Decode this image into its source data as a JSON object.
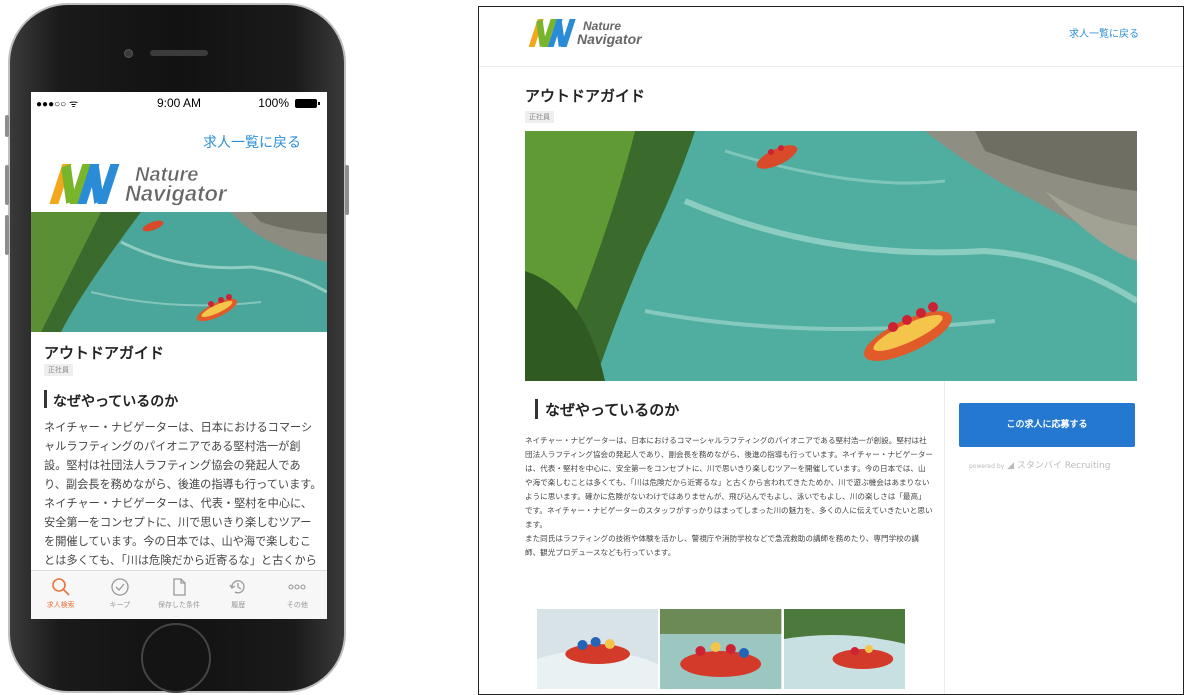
{
  "brand": {
    "line1": "Nature",
    "line2": "Navigator",
    "colors": [
      "#f2a71c",
      "#79b52a",
      "#2a8bd6",
      "#e8453c"
    ]
  },
  "status_bar": {
    "signal": "●●●○○ ᯤ",
    "time": "9:00 AM",
    "battery": "100%"
  },
  "job": {
    "back_link": "求人一覧に戻る",
    "title": "アウトドアガイド",
    "employment_type": "正社員",
    "section_title": "なぜやっているのか",
    "body": "ネイチャー・ナビゲーターは、日本におけるコマーシャルラフティングのパイオニアである堅村浩一が創設。堅村は社団法人ラフティング協会の発起人であり、副会長を務めながら、後進の指導も行っています。ネイチャー・ナビゲーターは、代表・堅村を中心に、安全第一をコンセプトに、川で思いきり楽しむツアーを開催しています。今の日本では、山や海で楽しむことは多くても、「川は危険だから近寄るな」と古くから言われてきたためか、川で遊ぶ機会はあまりないように思います。確かに危険がないわけではありませんが、飛び込んでもよし、泳いでもよし、川の楽しさは「最高」です。ネイチャー・ナビゲーターのスタッフがすっかりはまってしまった川の魅力を、多くの人に伝えていきたいと思います。",
    "body2": "また同氏はラフティングの技術や体験を活かし、警視庁や消防学校などで急流救助の講師を務めたり、専門学校の講師、観光プロデュースなども行っています。",
    "mobile_body_visible": "ネイチャー・ナビゲーターは、日本におけるコマーシャルラフティングのパイオニアである堅村浩一が創設。堅村は社団法人ラフティング協会の発起人であり、副会長を務めながら、後進の指導も行っています。ネイチャー・ナビゲーターは、代表・堅村を中心に、安全第一をコンセプトに、川で思いきり楽しむツアーを開催しています。今の日本では、山や海で楽しむことは多くても、「川は危険だから近寄るな」と古くから言われてきたためか、川で遊ぶ機会はあまりないように思います。"
  },
  "apply": {
    "button_label": "この求人に応募する",
    "powered_prefix": "powered by",
    "powered_brand": "スタンバイ",
    "powered_suffix": "Recruiting"
  },
  "tabbar": {
    "items": [
      {
        "label": "求人検索",
        "icon": "search-icon",
        "active": true
      },
      {
        "label": "キープ",
        "icon": "check-circle-icon",
        "active": false
      },
      {
        "label": "保存した条件",
        "icon": "document-icon",
        "active": false
      },
      {
        "label": "履歴",
        "icon": "history-icon",
        "active": false
      },
      {
        "label": "その他",
        "icon": "more-icon",
        "active": false
      }
    ]
  },
  "colors": {
    "link": "#2c8fd6",
    "apply_button": "#2478d0",
    "active_tab": "#e8733c",
    "river": "#4aa59a"
  }
}
